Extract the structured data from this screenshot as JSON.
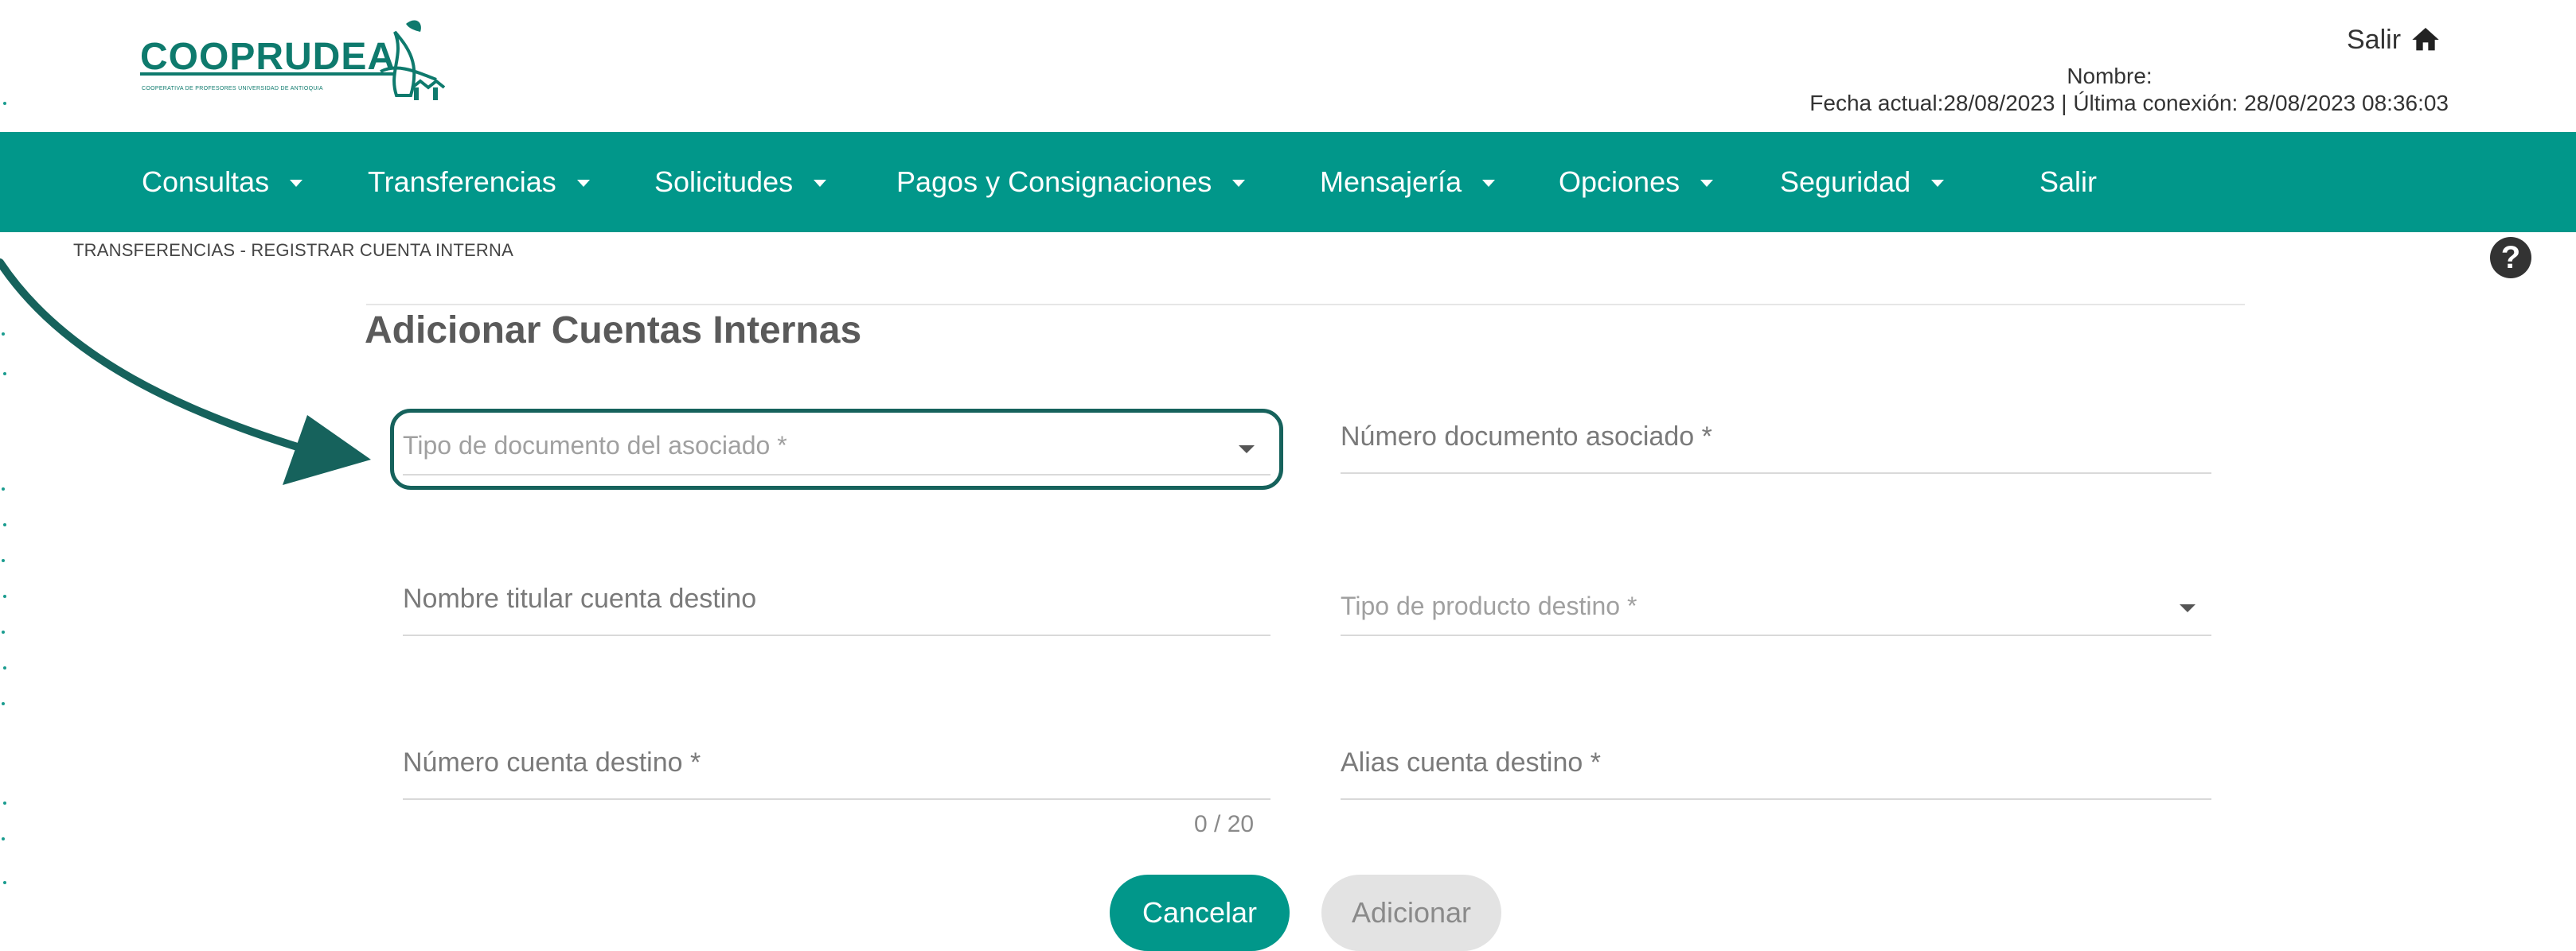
{
  "brand": {
    "logo_text": "COOPRUDEA",
    "logo_subtitle": "COOPERATIVA DE PROFESORES UNIVERSIDAD DE ANTIOQUIA",
    "color": "#0e7a6d"
  },
  "header": {
    "salir_label": "Salir",
    "home_icon": "home-icon",
    "name_label": "Nombre:",
    "dates_text": "Fecha actual:28/08/2023 | Última conexión: 28/08/2023 08:36:03"
  },
  "nav": {
    "color": "#01978a",
    "items": [
      {
        "label": "Consultas",
        "dropdown": true
      },
      {
        "label": "Transferencias",
        "dropdown": true
      },
      {
        "label": "Solicitudes",
        "dropdown": true
      },
      {
        "label": "Pagos y Consignaciones",
        "dropdown": true
      },
      {
        "label": "Mensajería",
        "dropdown": true
      },
      {
        "label": "Opciones",
        "dropdown": true
      },
      {
        "label": "Seguridad",
        "dropdown": true
      },
      {
        "label": "Salir",
        "dropdown": false
      }
    ]
  },
  "breadcrumb": "TRANSFERENCIAS - REGISTRAR CUENTA INTERNA",
  "help_icon": "question-circle-icon",
  "page_title": "Adicionar Cuentas Internas",
  "form": {
    "tipo_documento": {
      "label": "Tipo de documento del asociado *",
      "type": "select"
    },
    "numero_documento": {
      "label": "Número documento asociado *",
      "type": "input"
    },
    "nombre_titular": {
      "label": "Nombre titular cuenta destino",
      "type": "input"
    },
    "tipo_producto": {
      "label": "Tipo de producto destino *",
      "type": "select"
    },
    "numero_cuenta": {
      "label": "Número cuenta destino *",
      "type": "input",
      "counter": "0 / 20"
    },
    "alias_cuenta": {
      "label": "Alias cuenta destino *",
      "type": "input"
    }
  },
  "buttons": {
    "cancel": "Cancelar",
    "add": "Adicionar"
  },
  "annotation": {
    "highlight_color": "#16625c"
  }
}
